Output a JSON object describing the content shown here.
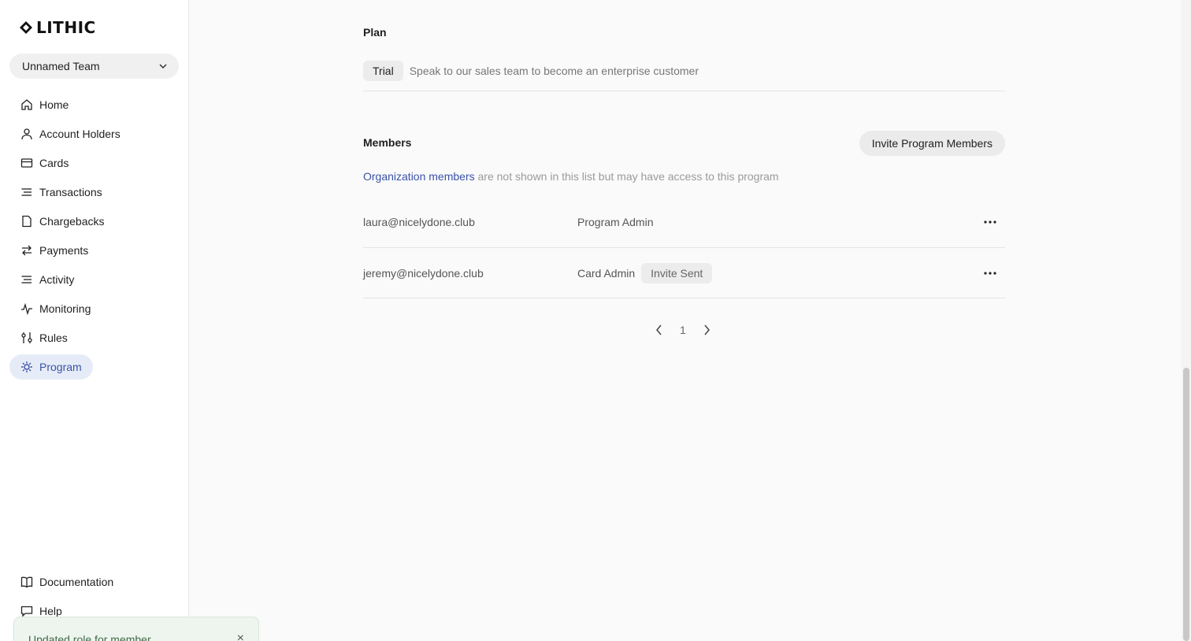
{
  "brand": {
    "name": "LITHIC",
    "accent": "#3a52a8"
  },
  "team": {
    "selected": "Unnamed Team"
  },
  "nav": {
    "items": [
      {
        "label": "Home",
        "icon": "home-icon"
      },
      {
        "label": "Account Holders",
        "icon": "user-icon"
      },
      {
        "label": "Cards",
        "icon": "card-icon"
      },
      {
        "label": "Transactions",
        "icon": "list-icon"
      },
      {
        "label": "Chargebacks",
        "icon": "document-icon"
      },
      {
        "label": "Payments",
        "icon": "arrows-icon"
      },
      {
        "label": "Activity",
        "icon": "list-icon"
      },
      {
        "label": "Monitoring",
        "icon": "pulse-icon"
      },
      {
        "label": "Rules",
        "icon": "sliders-icon"
      },
      {
        "label": "Program",
        "icon": "gear-icon",
        "active": true
      }
    ],
    "bottom": [
      {
        "label": "Documentation",
        "icon": "book-icon"
      },
      {
        "label": "Help",
        "icon": "chat-icon"
      }
    ]
  },
  "plan": {
    "title": "Plan",
    "badge": "Trial",
    "description": "Speak to our sales team to become an enterprise customer"
  },
  "members": {
    "title": "Members",
    "invite_button": "Invite Program Members",
    "note_link": "Organization members",
    "note_text": " are not shown in this list but may have access to this program",
    "rows": [
      {
        "email": "laura@nicelydone.club",
        "role": "Program Admin",
        "status": ""
      },
      {
        "email": "jeremy@nicelydone.club",
        "role": "Card Admin",
        "status": "Invite Sent"
      }
    ]
  },
  "pagination": {
    "current_page": "1"
  },
  "toast": {
    "message": "Updated role for member",
    "close": "×"
  }
}
